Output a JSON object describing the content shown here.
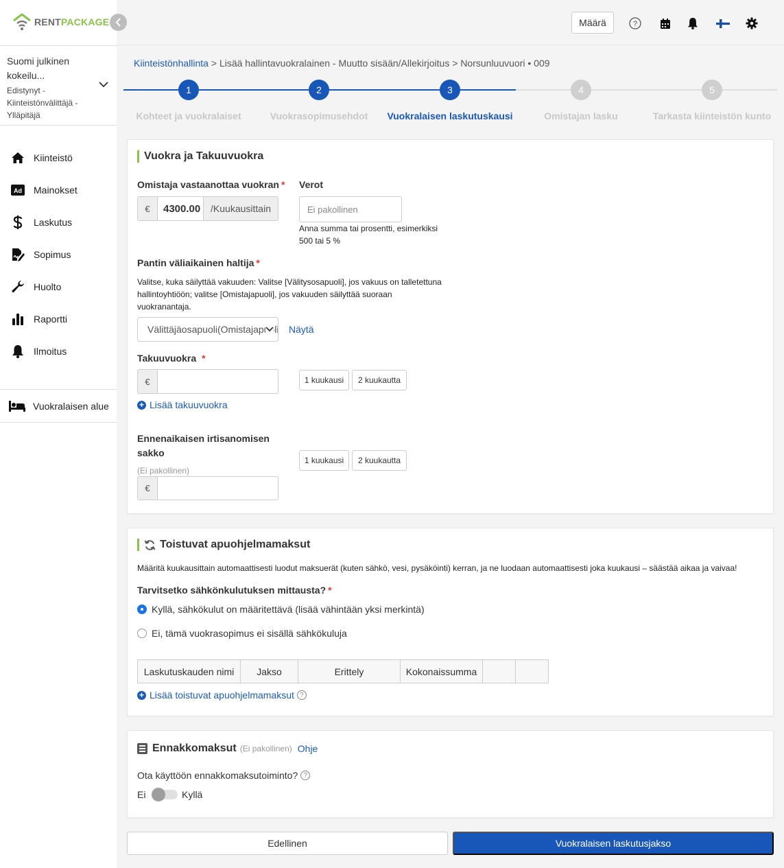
{
  "app": {
    "logo_part1": "RENT",
    "logo_part2": "PACKAGE"
  },
  "account": {
    "name": "Suomi julkinen kokeilu...",
    "role": "Edistynyt - Kiinteistönvälittäjä - Ylläpitäjä"
  },
  "nav": [
    {
      "label": "Kiinteistö",
      "icon": "home-icon"
    },
    {
      "label": "Mainokset",
      "icon": "ad-icon"
    },
    {
      "label": "Laskutus",
      "icon": "dollar-icon"
    },
    {
      "label": "Sopimus",
      "icon": "contract-icon"
    },
    {
      "label": "Huolto",
      "icon": "wrench-icon"
    },
    {
      "label": "Raportti",
      "icon": "bar-chart-icon"
    },
    {
      "label": "Ilmoitus",
      "icon": "bell-icon"
    }
  ],
  "tenant_area": {
    "label": "Vuokralaisen alue"
  },
  "topbar": {
    "maara_label": "Määrä"
  },
  "breadcrumb": {
    "root": "Kiinteistönhallinta",
    "sep": ">",
    "page": "Lisää hallintavuokralainen - Muutto sisään/Allekirjoitus",
    "property": "Norsunluuvuori • 009"
  },
  "steps": [
    {
      "num": "1",
      "label": "Kohteet ja vuokralaiset",
      "state": "done"
    },
    {
      "num": "2",
      "label": "Vuokrasopimusehdot",
      "state": "done"
    },
    {
      "num": "3",
      "label": "Vuokralaisen laskutuskausi",
      "state": "active"
    },
    {
      "num": "4",
      "label": "Omistajan lasku",
      "state": "todo"
    },
    {
      "num": "5",
      "label": "Tarkasta kiinteistön kunto",
      "state": "todo"
    }
  ],
  "rent_card": {
    "title": "Vuokra ja Takuuvuokra",
    "owner_label": "Omistaja vastaanottaa vuokran",
    "currency": "€",
    "rent_value": "4300.00",
    "rent_suffix": "/Kuukausittain",
    "tax_label": "Verot",
    "tax_placeholder": "Ei pakollinen",
    "tax_help": "Anna summa tai prosentti, esimerkiksi 500 tai 5 %",
    "pledge_label": "Pantin väliaikainen haltija",
    "pledge_help": "Valitse, kuka säilyttää vakuuden: Valitse [Välitysosapuoli], jos vakuus on talletettuna hallintoyhtiöön; valitse [Omistajapuoli], jos vakuuden säilyttää suoraan vuokranantaja.",
    "pledge_select": "Välittäjäosapuoli(Omistajapuoli)",
    "show_link": "Näytä",
    "deposit_label": "Takuuvuokra",
    "one_month": "1 kuukausi",
    "two_months": "2 kuukautta",
    "add_deposit": "Lisää takuuvuokra",
    "penalty_label": "Ennenaikaisen irtisanomisen sakko",
    "optional": "(Ei pakollinen)"
  },
  "utility_card": {
    "title": "Toistuvat apuohjelmamaksut",
    "description": "Määritä kuukausittain automaattisesti luodut maksuerät (kuten sähkö, vesi, pysäköinti) kerran, ja ne luodaan automaattisesti joka kuukausi – säästää aikaa ja vaivaa!",
    "question": "Tarvitsetko sähkönkulutuksen mittausta?",
    "opt_yes": "Kyllä, sähkökulut on määritettävä (lisää vähintään yksi merkintä)",
    "opt_no": "Ei, tämä vuokrasopimus ei sisällä sähkökuluja",
    "columns": [
      "Laskutuskauden nimi",
      "Jakso",
      "Erittely",
      "Kokonaissumma",
      "",
      ""
    ],
    "add_link": "Lisää toistuvat apuohjelmamaksut"
  },
  "prepay_card": {
    "title": "Ennakkomaksut",
    "optional": "(Ei pakollinen)",
    "help_link": "Ohje",
    "question": "Ota käyttöön ennakkomaksutoiminto?",
    "no": "Ei",
    "yes": "Kyllä"
  },
  "footer": {
    "prev": "Edellinen",
    "next": "Vuokralaisen laskutusjakso"
  },
  "colors": {
    "primary": "#1857b8",
    "accent_green": "#8bc34a",
    "link": "#1e5bb8",
    "required": "#e53935"
  }
}
